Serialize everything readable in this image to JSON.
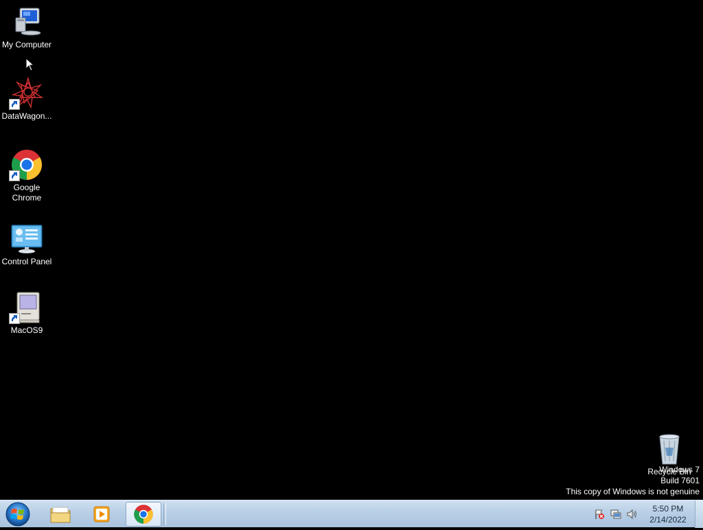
{
  "desktop": {
    "icons": [
      {
        "label": "My Computer"
      },
      {
        "label": "DataWagon..."
      },
      {
        "label": "Google Chrome"
      },
      {
        "label": "Control Panel"
      },
      {
        "label": "MacOS9"
      }
    ],
    "recycle_bin": {
      "label": "Recycle Bin"
    }
  },
  "watermark": {
    "line1": "Windows 7",
    "line2": "Build 7601",
    "line3": "This copy of Windows is not genuine"
  },
  "taskbar": {
    "pinned": [
      {
        "name": "windows-explorer"
      },
      {
        "name": "media-player"
      },
      {
        "name": "google-chrome",
        "active": true
      }
    ],
    "clock": {
      "time": "5:50 PM",
      "date": "2/14/2022"
    }
  },
  "colors": {
    "desktop_bg": "#000000",
    "taskbar_bg": "#b8cfe6"
  }
}
